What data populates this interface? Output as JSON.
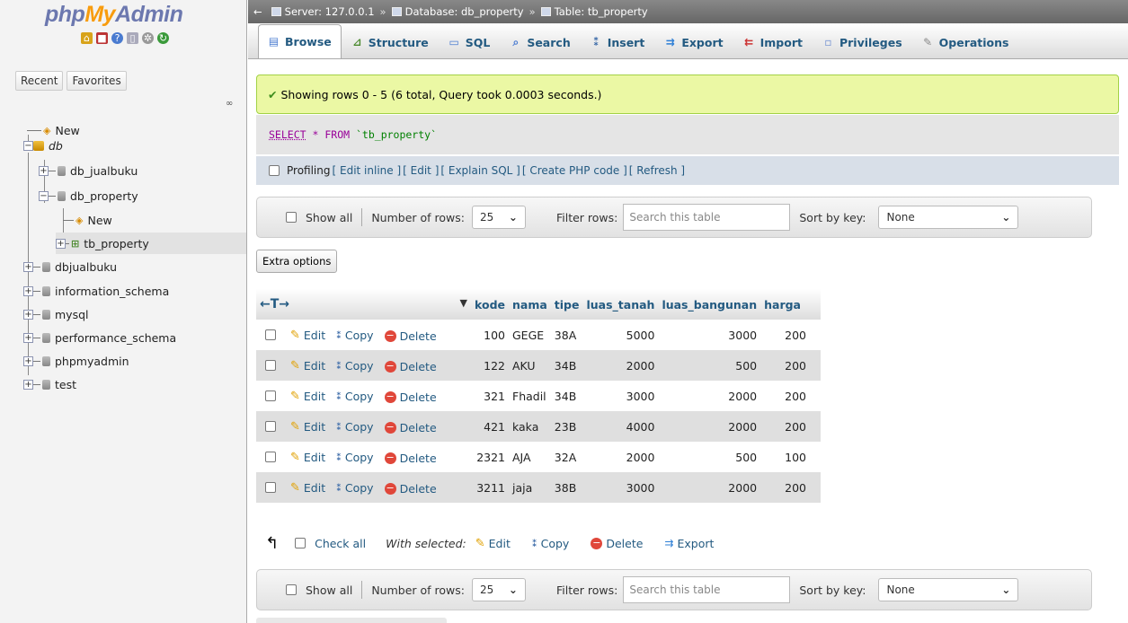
{
  "sidebar": {
    "logo": {
      "php": "php",
      "my": "My",
      "admin": "Admin"
    },
    "quick_icons": [
      "home-icon",
      "logout-icon",
      "help-icon",
      "docs-icon",
      "settings-icon",
      "reload-icon"
    ],
    "recent_label": "Recent",
    "favorites_label": "Favorites",
    "tree": {
      "new_root": "New",
      "db": "db",
      "db_jualbuku": "db_jualbuku",
      "db_property": "db_property",
      "new_child": "New",
      "tb_property": "tb_property",
      "dbjualbuku": "dbjualbuku",
      "information_schema": "information_schema",
      "mysql": "mysql",
      "performance_schema": "performance_schema",
      "phpmyadmin": "phpmyadmin",
      "test": "test"
    }
  },
  "breadcrumb": {
    "server": "Server: 127.0.0.1",
    "database": "Database: db_property",
    "table": "Table: tb_property",
    "sep": "»"
  },
  "tabs": {
    "browse": "Browse",
    "structure": "Structure",
    "sql": "SQL",
    "search": "Search",
    "insert": "Insert",
    "export": "Export",
    "import": "Import",
    "privileges": "Privileges",
    "operations": "Operations"
  },
  "message": "Showing rows 0 - 5 (6 total, Query took 0.0003 seconds.)",
  "query": {
    "select": "SELECT",
    "star": "*",
    "from": "FROM",
    "table": "`tb_property`"
  },
  "profiling": {
    "label": "Profiling",
    "edit_inline": "[ Edit inline ]",
    "edit": "[ Edit ]",
    "explain": "[ Explain SQL ]",
    "php": "[ Create PHP code ]",
    "refresh": "[ Refresh ]"
  },
  "nav": {
    "show_all": "Show all",
    "number_of_rows": "Number of rows:",
    "rows_value": "25",
    "filter_rows": "Filter rows:",
    "search_placeholder": "Search this table",
    "sort_by_key": "Sort by key:",
    "sort_value": "None"
  },
  "extra_options": "Extra options",
  "table": {
    "arrows": "←T→",
    "columns": [
      "kode",
      "nama",
      "tipe",
      "luas_tanah",
      "luas_bangunan",
      "harga"
    ],
    "action_edit": "Edit",
    "action_copy": "Copy",
    "action_delete": "Delete",
    "rows": [
      {
        "kode": "100",
        "nama": "GEGE",
        "tipe": "38A",
        "luas_tanah": "5000",
        "luas_bangunan": "3000",
        "harga": "200"
      },
      {
        "kode": "122",
        "nama": "AKU",
        "tipe": "34B",
        "luas_tanah": "2000",
        "luas_bangunan": "500",
        "harga": "200"
      },
      {
        "kode": "321",
        "nama": "Fhadil",
        "tipe": "34B",
        "luas_tanah": "3000",
        "luas_bangunan": "2000",
        "harga": "200"
      },
      {
        "kode": "421",
        "nama": "kaka",
        "tipe": "23B",
        "luas_tanah": "4000",
        "luas_bangunan": "2000",
        "harga": "200"
      },
      {
        "kode": "2321",
        "nama": "AJA",
        "tipe": "32A",
        "luas_tanah": "2000",
        "luas_bangunan": "500",
        "harga": "100"
      },
      {
        "kode": "3211",
        "nama": "jaja",
        "tipe": "38B",
        "luas_tanah": "3000",
        "luas_bangunan": "2000",
        "harga": "200"
      }
    ]
  },
  "bulk": {
    "check_all": "Check all",
    "with_selected": "With selected:",
    "edit": "Edit",
    "copy": "Copy",
    "delete": "Delete",
    "export": "Export"
  }
}
